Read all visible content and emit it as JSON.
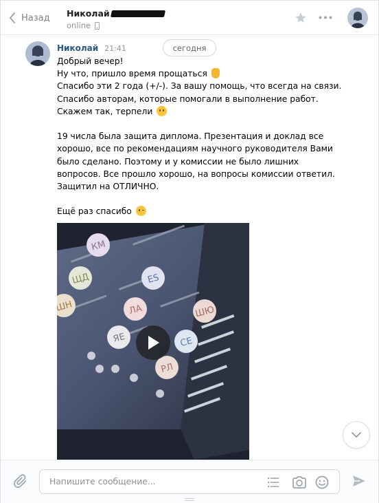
{
  "header": {
    "back_label": "Назад",
    "peer_name": "Николай",
    "peer_status": "online"
  },
  "date_divider": "сегодня",
  "message": {
    "author": "Николай",
    "time": "21:41",
    "lines": [
      "Добрый вечер!",
      "Ну что, пришло время прощаться",
      "Спасибо эти 2 года (+/-). За вашу помощь, что всегда на связи.",
      "Спасибо авторам, которые помогали в выполнение работ.",
      "Скажем так, терпели",
      "",
      "19 числа была защита диплома. Презентация и доклад все",
      "хорошо, все по рекомендациям научного руководителя Вами",
      "было сделано. Поэтому и у комиссии не было лишних",
      "вопросов. Все прошло хорошо, на вопросы комиссии ответил.",
      "Защитил на ОТЛИЧНО.",
      "",
      "Ещё раз спасибо"
    ],
    "emoji": {
      "line_1": "waving-hand-emoji",
      "line_4": "grinning-sweat-emoji",
      "line_12": "winking-face-emoji"
    },
    "video_participants": [
      "КМ",
      "ЩД",
      "ES",
      "ШН",
      "ЛА",
      "ШЮ",
      "ЯЕ",
      "СЕ",
      "РЛ"
    ]
  },
  "composer": {
    "placeholder": "Напишите сообщение..."
  },
  "colors": {
    "link": "#2a5885",
    "border": "#dce1e6",
    "muted": "#939393"
  }
}
